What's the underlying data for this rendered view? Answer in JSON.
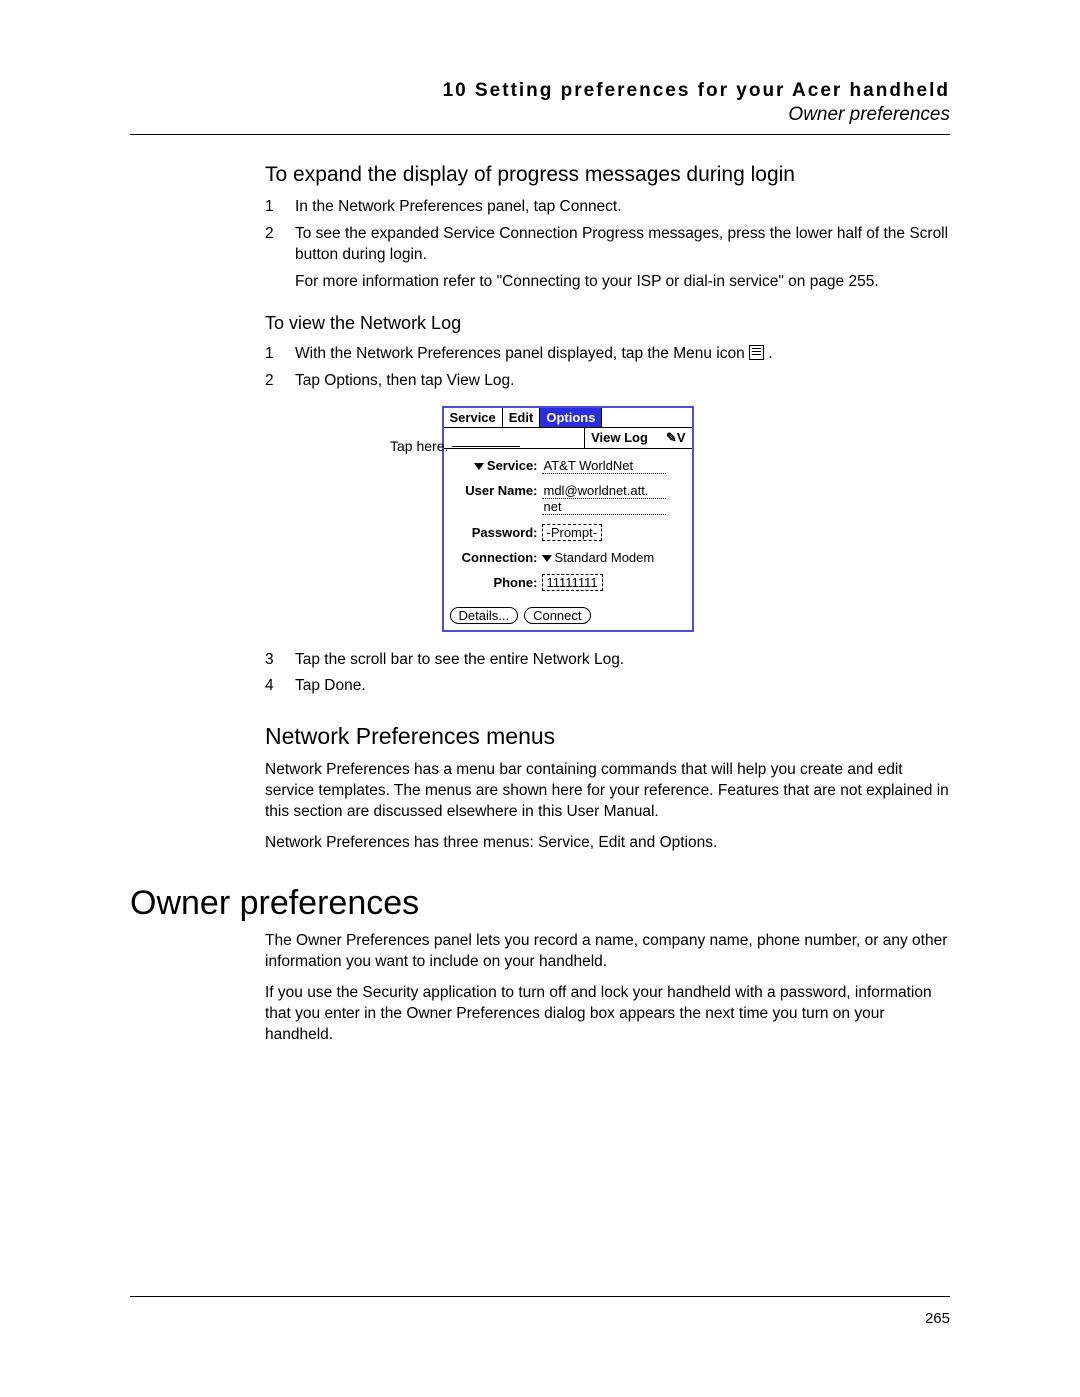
{
  "header": {
    "running": "10 Setting preferences for your Acer handheld",
    "section": "Owner preferences"
  },
  "sec_expand": {
    "heading": "To expand the display of progress messages during login",
    "steps": {
      "s1": "In the Network Preferences panel, tap Connect.",
      "s2": "To see the expanded Service Connection Progress messages, press the lower half of the Scroll button during login.",
      "s2b": "For more information refer to \"Connecting to your ISP or dial-in service\" on page 255."
    }
  },
  "sec_viewlog": {
    "heading": "To view the Network Log",
    "steps": {
      "s1a": "With the Network Preferences panel displayed, tap the Menu icon ",
      "s1b": ".",
      "s2": "Tap Options, then tap View Log.",
      "s3": "Tap the scroll bar to see the entire Network Log.",
      "s4": "Tap Done."
    }
  },
  "figure": {
    "callout": "Tap here.",
    "menu": {
      "service": "Service",
      "edit": "Edit",
      "options": "Options"
    },
    "submenu": {
      "viewlog": "View Log",
      "shortcut": "✓V"
    },
    "fields": {
      "service_label": "Service:",
      "service_value": "AT&T WorldNet",
      "username_label": "User Name:",
      "username_value": "mdl@worldnet.att.net",
      "password_label": "Password:",
      "password_value": "-Prompt-",
      "connection_label": "Connection:",
      "connection_value": "Standard Modem",
      "phone_label": "Phone:",
      "phone_value": "11111111"
    },
    "buttons": {
      "details": "Details...",
      "connect": "Connect"
    }
  },
  "sec_menus": {
    "heading": "Network Preferences menus",
    "p1": "Network Preferences has a menu bar containing commands that will help you create and edit service templates. The menus are shown here for your reference. Features that are not explained in this section are discussed elsewhere in this User Manual.",
    "p2": "Network Preferences has three menus: Service, Edit and Options."
  },
  "sec_owner": {
    "heading": "Owner preferences",
    "p1": "The Owner Preferences panel lets you record a name, company name, phone number, or any other information you want to include on your handheld.",
    "p2": "If you use the Security application to turn off and lock your handheld with a password, information that you enter in the Owner Preferences dialog box appears the next time you turn on your handheld."
  },
  "page_number": "265"
}
